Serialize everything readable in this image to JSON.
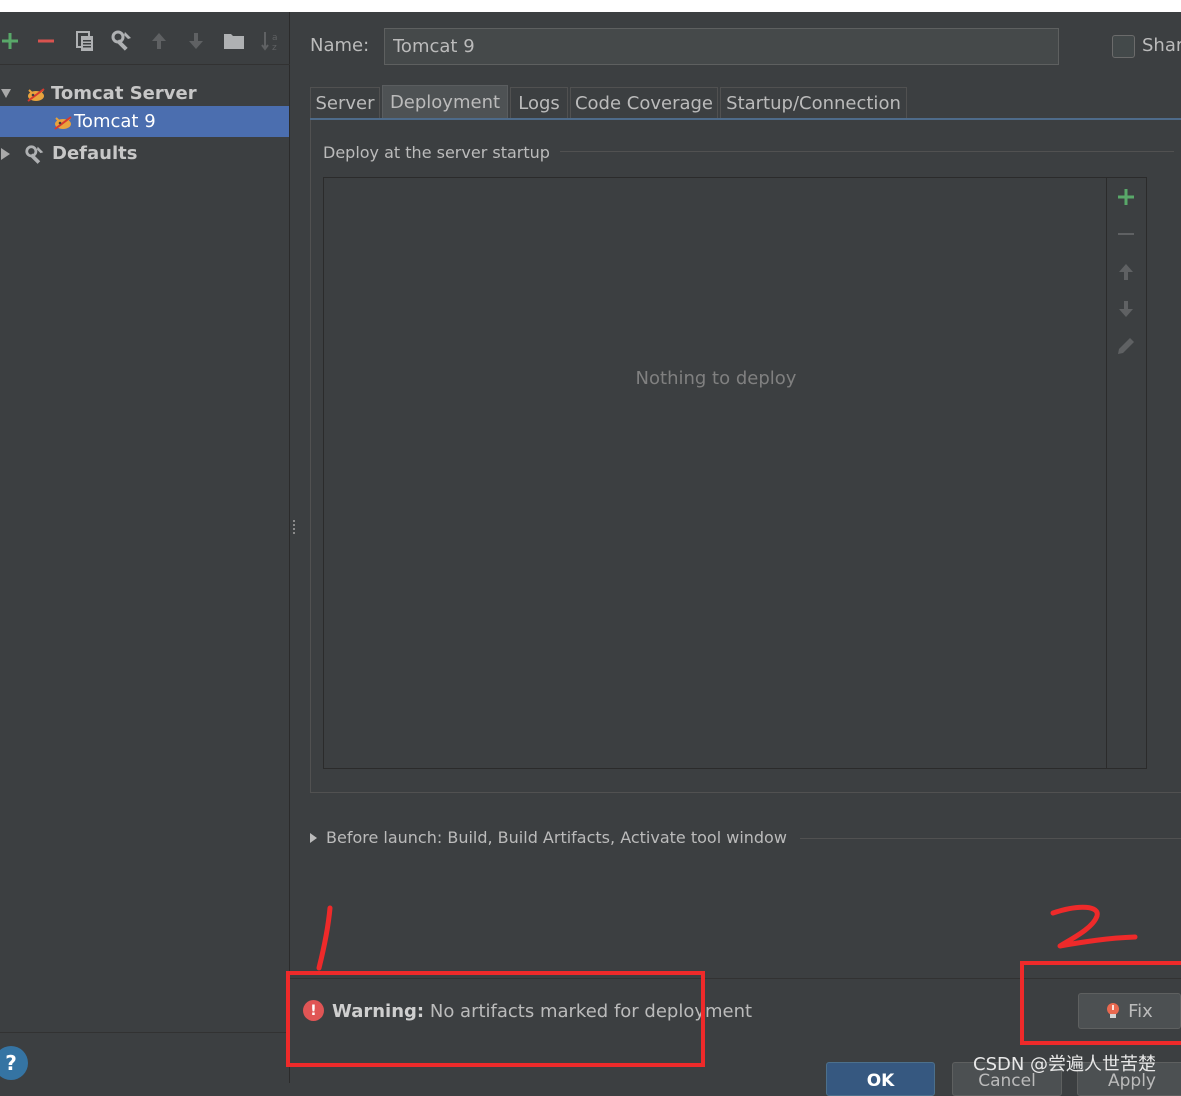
{
  "left_toolbar": {
    "icons": [
      "add-icon",
      "remove-icon",
      "copy-icon",
      "edit-defaults-icon",
      "move-up-icon",
      "move-down-icon",
      "folder-icon",
      "sort-icon"
    ]
  },
  "tree": {
    "group_label": "Tomcat Server",
    "selected_item_label": "Tomcat 9",
    "defaults_label": "Defaults"
  },
  "form": {
    "name_label": "Name:",
    "name_value": "Tomcat 9",
    "share_label": "Shar"
  },
  "tabs": [
    {
      "label": "Server"
    },
    {
      "label": "Deployment"
    },
    {
      "label": "Logs"
    },
    {
      "label": "Code Coverage"
    },
    {
      "label": "Startup/Connection"
    }
  ],
  "deployment": {
    "group_title": "Deploy at the server startup",
    "empty_text": "Nothing to deploy"
  },
  "before_launch": {
    "label": "Before launch: Build, Build Artifacts, Activate tool window"
  },
  "warning": {
    "prefix": "Warning:",
    "message": "No artifacts marked for deployment"
  },
  "buttons": {
    "fix": "Fix",
    "ok": "OK",
    "cancel": "Cancel",
    "apply": "Apply",
    "help": "?"
  },
  "watermark": "CSDN @尝遍人世苦楚",
  "colors": {
    "background": "#3c3f41",
    "selection": "#4b6eaf",
    "annotation_red": "#ee2a2a",
    "add_green": "#59a869",
    "remove_red": "#d9534f"
  }
}
